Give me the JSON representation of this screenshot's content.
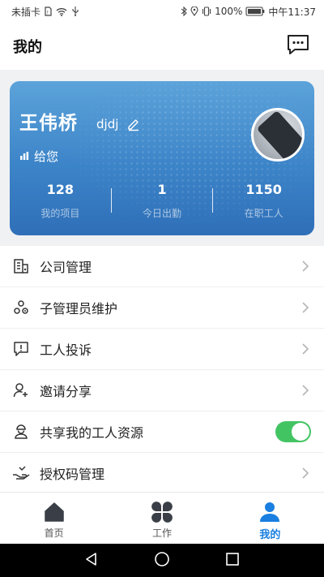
{
  "status_bar": {
    "carrier": "未插卡",
    "battery": "100%",
    "time": "中午11:37"
  },
  "header": {
    "title": "我的",
    "chat_icon": "message-dots-icon"
  },
  "profile": {
    "name": "王伟桥",
    "nickname": "djdj",
    "company": "给您",
    "stats": [
      {
        "value": "128",
        "label": "我的项目"
      },
      {
        "value": "1",
        "label": "今日出勤"
      },
      {
        "value": "1150",
        "label": "在职工人"
      }
    ]
  },
  "menu": {
    "items": [
      {
        "label": "公司管理",
        "icon": "building-icon"
      },
      {
        "label": "子管理员维护",
        "icon": "sub-admin-icon"
      },
      {
        "label": "工人投诉",
        "icon": "complaint-icon"
      },
      {
        "label": "邀请分享",
        "icon": "invite-user-icon"
      },
      {
        "label": "共享我的工人资源",
        "icon": "worker-share-icon",
        "toggle": true
      },
      {
        "label": "授权码管理",
        "icon": "hand-key-icon"
      }
    ]
  },
  "bottom_nav": {
    "tabs": [
      {
        "label": "首页",
        "icon": "home-icon"
      },
      {
        "label": "工作",
        "icon": "grid-clover-icon"
      },
      {
        "label": "我的",
        "icon": "user-icon",
        "active": true
      }
    ]
  },
  "colors": {
    "accent": "#1a7fe0",
    "card_top": "#5ca3da",
    "card_bottom": "#2f6fb8",
    "toggle_on": "#43c463"
  }
}
